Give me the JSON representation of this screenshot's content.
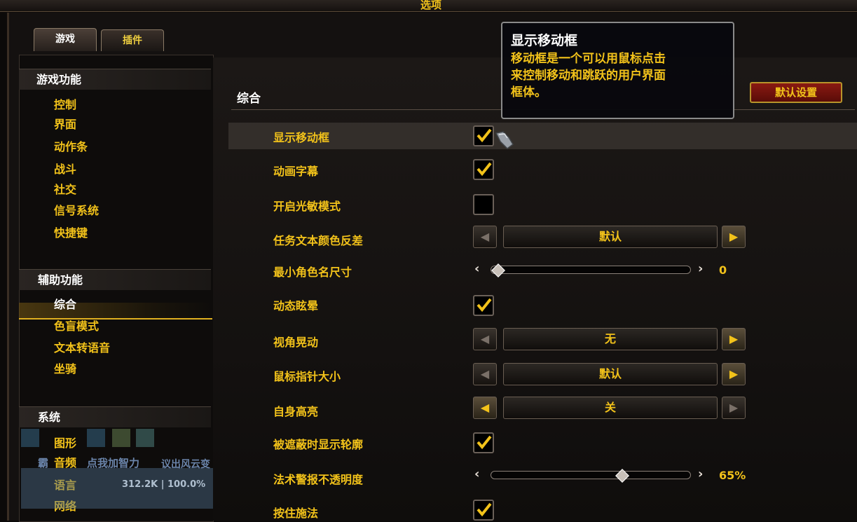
{
  "window": {
    "title": "选项"
  },
  "tabs": [
    {
      "label": "游戏",
      "active": true
    },
    {
      "label": "插件",
      "active": false
    }
  ],
  "sidebar": {
    "categories": [
      {
        "label": "游戏功能",
        "items": [
          "控制",
          "界面",
          "动作条",
          "战斗",
          "社交",
          "信号系统",
          "快捷键"
        ]
      },
      {
        "label": "辅助功能",
        "items": [
          "综合",
          "色盲模式",
          "文本转语音",
          "坐骑"
        ],
        "selected": "综合"
      },
      {
        "label": "系统",
        "items": [
          "图形",
          "音频",
          "语言",
          "网络"
        ]
      }
    ]
  },
  "main": {
    "section_title": "综合",
    "default_button": "默认设置",
    "settings": [
      {
        "label": "显示移动框",
        "type": "checkbox",
        "checked": true
      },
      {
        "label": "动画字幕",
        "type": "checkbox",
        "checked": true
      },
      {
        "label": "开启光敏模式",
        "type": "checkbox",
        "checked": false
      },
      {
        "label": "任务文本颜色反差",
        "type": "dropdown",
        "value": "默认"
      },
      {
        "label": "最小角色名尺寸",
        "type": "slider",
        "value": "0",
        "fraction": 0.0
      },
      {
        "label": "动态眩晕",
        "type": "checkbox",
        "checked": true
      },
      {
        "label": "视角晃动",
        "type": "dropdown",
        "value": "无"
      },
      {
        "label": "鼠标指针大小",
        "type": "dropdown",
        "value": "默认"
      },
      {
        "label": "自身高亮",
        "type": "dropdown",
        "value": "关"
      },
      {
        "label": "被遮蔽时显示轮廓",
        "type": "checkbox",
        "checked": true
      },
      {
        "label": "法术警报不透明度",
        "type": "slider",
        "value": "65%",
        "fraction": 0.65
      },
      {
        "label": "按住施法",
        "type": "checkbox",
        "checked": true
      }
    ]
  },
  "tooltip": {
    "title": "显示移动框",
    "body_lines": [
      "移动框是一个可以用鼠标点击",
      "来控制移动和跳跃的用户界面",
      "框体。"
    ]
  },
  "overlay": {
    "promo": "点我加智力",
    "promo_tail": "议出风云变",
    "stats": "312.2K | 100.0%",
    "prefix": "霸"
  },
  "colors": {
    "gold": "#f2c21a",
    "white": "#ffffff",
    "bg": "#141110"
  },
  "icons": {
    "check": "check-icon",
    "left": "arrow-left-icon",
    "right": "arrow-right-icon",
    "cursor": "gauntlet-cursor-icon"
  }
}
